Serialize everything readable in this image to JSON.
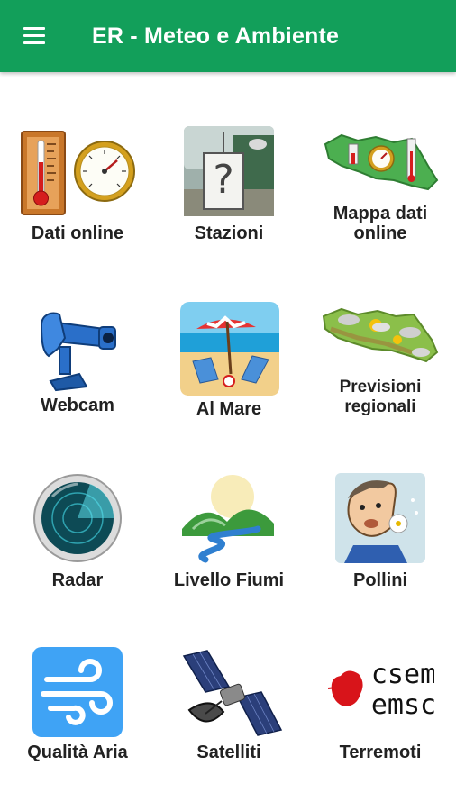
{
  "appbar": {
    "title": "ER - Meteo e Ambiente",
    "color": "#129f5a"
  },
  "tiles": [
    {
      "label": "Dati online",
      "icon": "thermometer-gauge-icon"
    },
    {
      "label": "Stazioni",
      "icon": "weather-station-icon"
    },
    {
      "label": "Mappa dati online",
      "icon": "region-map-gauge-icon"
    },
    {
      "label": "Webcam",
      "icon": "webcam-icon"
    },
    {
      "label": "Al Mare",
      "icon": "beach-icon"
    },
    {
      "label": "Previsioni regionali",
      "icon": "forecast-map-icon"
    },
    {
      "label": "Radar",
      "icon": "radar-icon"
    },
    {
      "label": "Livello Fiumi",
      "icon": "river-icon"
    },
    {
      "label": "Pollini",
      "icon": "pollen-icon"
    },
    {
      "label": "Qualità Aria",
      "icon": "wind-icon"
    },
    {
      "label": "Satelliti",
      "icon": "satellite-icon"
    },
    {
      "label": "Terremoti",
      "icon": "earthquake-icon"
    }
  ],
  "logo_text": {
    "line1": "csem",
    "line2": "emsc"
  }
}
